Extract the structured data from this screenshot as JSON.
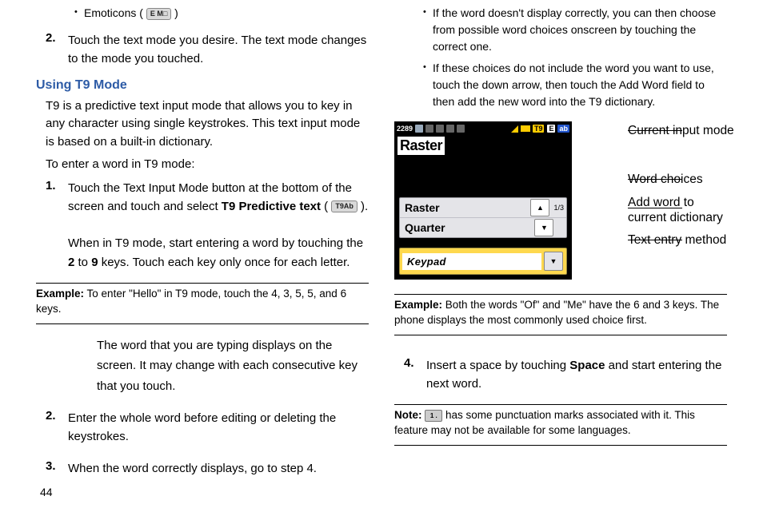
{
  "col1": {
    "emoticons_label": "Emoticons (",
    "emoticons_close": ")",
    "emo_chip": "E M□",
    "step2_text": "Touch the text mode you desire. The text mode changes to the mode you touched.",
    "heading": "Using T9 Mode",
    "intro": "T9 is a predictive text input mode that allows you to key in any character using single keystrokes. This text input mode is based on a built-in dictionary.",
    "to_enter": "To enter a word in T9 mode:",
    "ol1_a": "Touch the Text Input Mode button at the bottom of the screen and touch and select ",
    "ol1_bold": "T9 Predictive text",
    "ol1_b": " ( ",
    "ol1_chip": "T9Ab",
    "ol1_c": " ).",
    "ol1_d": "When in T9 mode, start entering a word by touching the ",
    "ol1_d_key2": "2",
    "ol1_d_to": " to ",
    "ol1_d_key9": "9",
    "ol1_d_end": " keys. Touch each key only once for each letter.",
    "example_label": "Example:",
    "example_text": " To enter \"Hello\" in T9 mode, touch the 4, 3, 5, 5, and 6 keys.",
    "after1": "The word that you are typing displays on the screen. It may change with each consecutive key that you touch.",
    "ol2": "Enter the whole word before editing or deleting the keystrokes.",
    "ol3": "When the word correctly displays, go to step 4."
  },
  "col2": {
    "b1": "If the word doesn't display correctly, you can then choose from possible word choices onscreen by touching the correct one.",
    "b2": "If these choices do not include the word you want to use, touch the down arrow, then touch the Add Word field to then add the new word into the T9 dictionary.",
    "phone": {
      "time": "2289",
      "t9": "T9",
      "e": "E",
      "ab": "ab",
      "word": "Raster",
      "choice1": "Raster",
      "choice2": "Quarter",
      "page": "1/3",
      "keypad": "Keypad"
    },
    "callouts": {
      "c1": "Current input mode",
      "c2": "Word choices",
      "c3a": "Add word to",
      "c3b": "current dictionary",
      "c4": "Text entry method"
    },
    "example_label": "Example:",
    "example_text": " Both the words \"Of\" and \"Me\" have the 6 and 3 keys. The phone displays the most commonly used choice first.",
    "ol4_a": "Insert a space by touching ",
    "ol4_bold": "Space",
    "ol4_b": " and start entering the next word.",
    "note_label": "Note:",
    "note_key": "1 .",
    "note_text": " has some punctuation marks associated with it. This feature may not be available for some languages."
  },
  "pagenum": "44"
}
